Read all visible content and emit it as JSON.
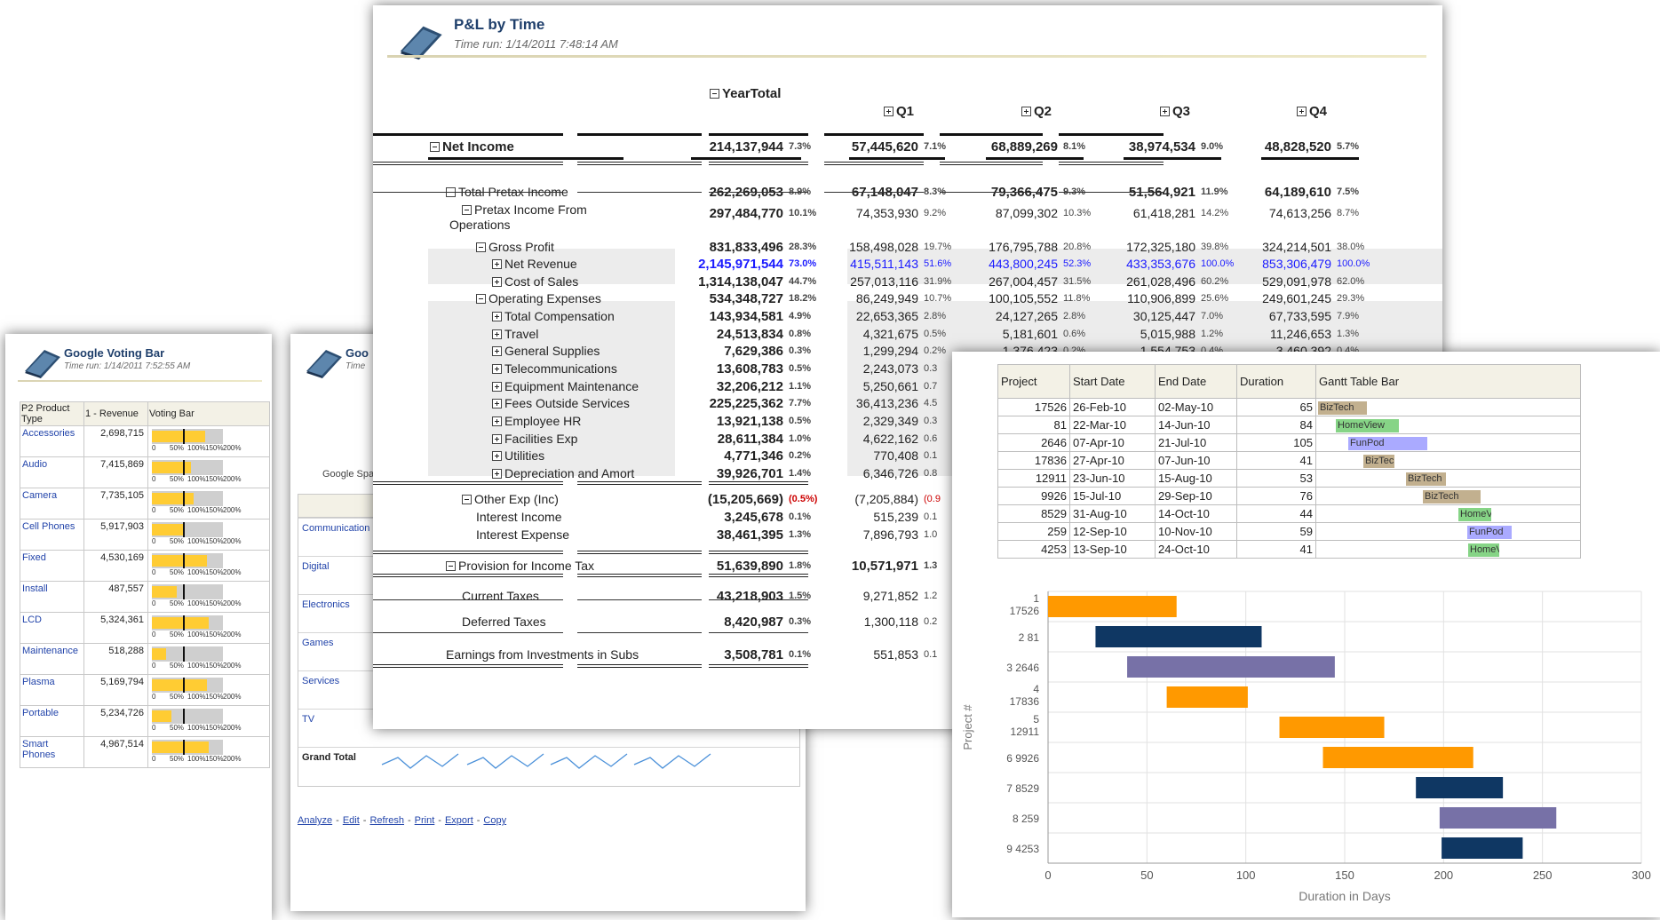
{
  "pl": {
    "title": "P&L by Time",
    "time_run": "Time run: 1/14/2011 7:48:14 AM",
    "year_total": "YearTotal",
    "quarters": [
      "Q1",
      "Q2",
      "Q3",
      "Q4"
    ],
    "rows": [
      {
        "label": "Net Income",
        "y": 0,
        "indent": 0,
        "icon": "minus",
        "bold": true,
        "cells": [
          [
            "214,137,944",
            "7.3%"
          ],
          [
            "57,445,620",
            "7.1%"
          ],
          [
            "68,889,269",
            "8.1%"
          ],
          [
            "38,974,534",
            "9.0%"
          ],
          [
            "48,828,520",
            "5.7%"
          ]
        ]
      },
      {
        "label": "Total Pretax Income",
        "indent": 1,
        "icon": "minus",
        "cells": [
          [
            "262,269,053",
            "8.9%"
          ],
          [
            "67,148,047",
            "8.3%"
          ],
          [
            "79,366,475",
            "9.3%"
          ],
          [
            "51,564,921",
            "11.9%"
          ],
          [
            "64,189,610",
            "7.5%"
          ]
        ]
      },
      {
        "label": "Pretax Income From",
        "label2": "Operations",
        "indent": 2,
        "icon": "minus",
        "cells": [
          [
            "297,484,770",
            "10.1%"
          ],
          [
            "74,353,930",
            "9.2%"
          ],
          [
            "87,099,302",
            "10.3%"
          ],
          [
            "61,418,281",
            "14.2%"
          ],
          [
            "74,613,256",
            "8.7%"
          ]
        ]
      },
      {
        "label": "Gross Profit",
        "indent": 3,
        "icon": "minus",
        "cells": [
          [
            "831,833,496",
            "28.3%"
          ],
          [
            "158,498,028",
            "19.7%"
          ],
          [
            "176,795,788",
            "20.8%"
          ],
          [
            "172,325,180",
            "39.8%"
          ],
          [
            "324,214,501",
            "38.0%"
          ]
        ]
      },
      {
        "label": "Net Revenue",
        "indent": 4,
        "icon": "plus",
        "blue": true,
        "cells": [
          [
            "2,145,971,544",
            "73.0%"
          ],
          [
            "415,511,143",
            "51.6%"
          ],
          [
            "443,800,245",
            "52.3%"
          ],
          [
            "433,353,676",
            "100.0%"
          ],
          [
            "853,306,479",
            "100.0%"
          ]
        ]
      },
      {
        "label": "Cost of Sales",
        "indent": 4,
        "icon": "plus",
        "cells": [
          [
            "1,314,138,047",
            "44.7%"
          ],
          [
            "257,013,116",
            "31.9%"
          ],
          [
            "267,004,457",
            "31.5%"
          ],
          [
            "261,028,496",
            "60.2%"
          ],
          [
            "529,091,978",
            "62.0%"
          ]
        ]
      },
      {
        "label": "Operating Expenses",
        "indent": 3,
        "icon": "minus",
        "cells": [
          [
            "534,348,727",
            "18.2%"
          ],
          [
            "86,249,949",
            "10.7%"
          ],
          [
            "100,105,552",
            "11.8%"
          ],
          [
            "110,906,899",
            "25.6%"
          ],
          [
            "249,601,245",
            "29.3%"
          ]
        ]
      },
      {
        "label": "Total Compensation",
        "indent": 4,
        "icon": "plus",
        "cells": [
          [
            "143,934,581",
            "4.9%"
          ],
          [
            "22,653,365",
            "2.8%"
          ],
          [
            "24,127,265",
            "2.8%"
          ],
          [
            "30,125,447",
            "7.0%"
          ],
          [
            "67,733,595",
            "7.9%"
          ]
        ]
      },
      {
        "label": "Travel",
        "indent": 4,
        "icon": "plus",
        "cells": [
          [
            "24,513,834",
            "0.8%"
          ],
          [
            "4,321,675",
            "0.5%"
          ],
          [
            "5,181,601",
            "0.6%"
          ],
          [
            "5,015,988",
            "1.2%"
          ],
          [
            "11,246,653",
            "1.3%"
          ]
        ]
      },
      {
        "label": "General Supplies",
        "indent": 4,
        "icon": "plus",
        "cells": [
          [
            "7,629,386",
            "0.3%"
          ],
          [
            "1,299,294",
            "0.2%"
          ],
          [
            "1,376,423",
            "0.2%"
          ],
          [
            "1,554,753",
            "0.4%"
          ],
          [
            "3,460,392",
            "0.4%"
          ]
        ]
      },
      {
        "label": "Telecommunications",
        "indent": 4,
        "icon": "plus",
        "cells": [
          [
            "13,608,783",
            "0.5%"
          ],
          [
            "2,243,073",
            "0.3"
          ]
        ]
      },
      {
        "label": "Equipment Maintenance",
        "indent": 4,
        "icon": "plus",
        "cells": [
          [
            "32,206,212",
            "1.1%"
          ],
          [
            "5,250,661",
            "0.7"
          ]
        ]
      },
      {
        "label": "Fees Outside Services",
        "indent": 4,
        "icon": "plus",
        "cells": [
          [
            "225,225,362",
            "7.7%"
          ],
          [
            "36,413,236",
            "4.5"
          ]
        ]
      },
      {
        "label": "Employee HR",
        "indent": 4,
        "icon": "plus",
        "cells": [
          [
            "13,921,138",
            "0.5%"
          ],
          [
            "2,329,349",
            "0.3"
          ]
        ]
      },
      {
        "label": "Facilities Exp",
        "indent": 4,
        "icon": "plus",
        "cells": [
          [
            "28,611,384",
            "1.0%"
          ],
          [
            "4,622,162",
            "0.6"
          ]
        ]
      },
      {
        "label": "Utilities",
        "indent": 4,
        "icon": "plus",
        "cells": [
          [
            "4,771,346",
            "0.2%"
          ],
          [
            "770,408",
            "0.1"
          ]
        ]
      },
      {
        "label": "Depreciation and Amort",
        "indent": 4,
        "icon": "plus",
        "cells": [
          [
            "39,926,701",
            "1.4%"
          ],
          [
            "6,346,726",
            "0.8"
          ]
        ]
      },
      {
        "label": "Other Exp (Inc)",
        "indent": 2,
        "icon": "minus",
        "neg": true,
        "cells": [
          [
            "(15,205,669)",
            "(0.5%)"
          ],
          [
            "(7,205,884)",
            "(0.9"
          ]
        ]
      },
      {
        "label": "Interest Income",
        "indent": 3,
        "icon": "none",
        "cells": [
          [
            "3,245,678",
            "0.1%"
          ],
          [
            "515,239",
            "0.1"
          ]
        ]
      },
      {
        "label": "Interest Expense",
        "indent": 3,
        "icon": "none",
        "cells": [
          [
            "38,461,395",
            "1.3%"
          ],
          [
            "7,896,793",
            "1.0"
          ]
        ]
      },
      {
        "label": "Provision for Income Tax",
        "indent": 1,
        "icon": "minus",
        "cells": [
          [
            "51,639,890",
            "1.8%"
          ],
          [
            "10,571,971",
            "1.3"
          ]
        ]
      },
      {
        "label": "Current Taxes",
        "indent": 2,
        "icon": "none",
        "cells": [
          [
            "43,218,903",
            "1.5%"
          ],
          [
            "9,271,852",
            "1.2"
          ]
        ]
      },
      {
        "label": "Deferred Taxes",
        "indent": 2,
        "icon": "none",
        "cells": [
          [
            "8,420,987",
            "0.3%"
          ],
          [
            "1,300,118",
            "0.2"
          ]
        ]
      },
      {
        "label": "Earnings from Investments in Subs",
        "indent": 1,
        "icon": "none",
        "cells": [
          [
            "3,508,781",
            "0.1%"
          ],
          [
            "551,853",
            "0.1"
          ]
        ]
      }
    ]
  },
  "voting": {
    "title": "Google Voting Bar",
    "time_run": "Time run: 1/14/2011 7:52:55 AM",
    "headers": [
      "P2 Product Type",
      "1 - Revenue",
      "Voting Bar"
    ],
    "scale": [
      "0",
      "50%",
      "100%",
      "150%",
      "200%"
    ],
    "rows": [
      {
        "type": "Accessories",
        "revenue": "2,698,715",
        "fill": 0.75,
        "marker": 0.44
      },
      {
        "type": "Audio",
        "revenue": "7,415,869",
        "fill": 0.55,
        "marker": 0.44
      },
      {
        "type": "Camera",
        "revenue": "7,735,105",
        "fill": 0.59,
        "marker": 0.44
      },
      {
        "type": "Cell Phones",
        "revenue": "5,917,903",
        "fill": 0.45,
        "marker": 0.44
      },
      {
        "type": "Fixed",
        "revenue": "4,530,169",
        "fill": 0.78,
        "marker": 0.44
      },
      {
        "type": "Install",
        "revenue": "487,557",
        "fill": 0.35,
        "marker": 0.44
      },
      {
        "type": "LCD",
        "revenue": "5,324,361",
        "fill": 0.8,
        "marker": 0.44
      },
      {
        "type": "Maintenance",
        "revenue": "518,288",
        "fill": 0.2,
        "marker": 0.44
      },
      {
        "type": "Plasma",
        "revenue": "5,169,794",
        "fill": 0.78,
        "marker": 0.44
      },
      {
        "type": "Portable",
        "revenue": "5,234,726",
        "fill": 0.27,
        "marker": 0.44
      },
      {
        "type": "Smart Phones",
        "revenue": "4,967,514",
        "fill": 0.8,
        "marker": 0.44
      }
    ]
  },
  "spark": {
    "title": "Goo",
    "time_run": "Time",
    "subtitle": "Google Spa",
    "categories": [
      "Communication",
      "Digital",
      "Electronics",
      "Games",
      "Services",
      "TV",
      "Grand Total"
    ],
    "links": [
      "Analyze",
      "Edit",
      "Refresh",
      "Print",
      "Export",
      "Copy"
    ],
    "separators": [
      "-",
      "-",
      "-",
      "-",
      "-"
    ]
  },
  "gantt_table": {
    "headers": [
      "Project",
      "Start Date",
      "End Date",
      "Duration",
      "Gantt Table Bar"
    ],
    "rows": [
      {
        "project": "17526",
        "start": "26-Feb-10",
        "end": "02-May-10",
        "duration": "65",
        "bar": "BizTech",
        "color": "#c2b08f"
      },
      {
        "project": "81",
        "start": "22-Mar-10",
        "end": "14-Jun-10",
        "duration": "84",
        "bar": "HomeView",
        "color": "#86d486"
      },
      {
        "project": "2646",
        "start": "07-Apr-10",
        "end": "21-Jul-10",
        "duration": "105",
        "bar": "FunPod",
        "color": "#aaaaff"
      },
      {
        "project": "17836",
        "start": "27-Apr-10",
        "end": "07-Jun-10",
        "duration": "41",
        "bar": "BizTech",
        "color": "#c2b08f"
      },
      {
        "project": "12911",
        "start": "23-Jun-10",
        "end": "15-Aug-10",
        "duration": "53",
        "bar": "BizTech",
        "color": "#c2b08f"
      },
      {
        "project": "9926",
        "start": "15-Jul-10",
        "end": "29-Sep-10",
        "duration": "76",
        "bar": "BizTech",
        "color": "#c2b08f"
      },
      {
        "project": "8529",
        "start": "31-Aug-10",
        "end": "14-Oct-10",
        "duration": "44",
        "bar": "HomeView",
        "color": "#86d486"
      },
      {
        "project": "259",
        "start": "12-Sep-10",
        "end": "10-Nov-10",
        "duration": "59",
        "bar": "FunPod",
        "color": "#aaaaff"
      },
      {
        "project": "4253",
        "start": "13-Sep-10",
        "end": "24-Oct-10",
        "duration": "41",
        "bar": "HomeView",
        "color": "#86d486"
      }
    ]
  },
  "chart_data": {
    "type": "bar",
    "orientation": "horizontal-floating",
    "xlabel": "Duration in Days",
    "ylabel": "Project #",
    "xlim": [
      0,
      300
    ],
    "xticks": [
      "0",
      "50",
      "100",
      "150",
      "200",
      "250",
      "300"
    ],
    "grid": true,
    "categories": [
      [
        "1",
        "17526"
      ],
      [
        "2 81"
      ],
      [
        "3 2646"
      ],
      [
        "4",
        "17836"
      ],
      [
        "5",
        "12911"
      ],
      [
        "6 9926"
      ],
      [
        "7 8529"
      ],
      [
        "8 259"
      ],
      [
        "9 4253"
      ]
    ],
    "bars": [
      {
        "start": 0,
        "end": 65,
        "color": "#ff9900"
      },
      {
        "start": 24,
        "end": 108,
        "color": "#0f3763"
      },
      {
        "start": 40,
        "end": 145,
        "color": "#7771a7"
      },
      {
        "start": 60,
        "end": 101,
        "color": "#ff9900"
      },
      {
        "start": 117,
        "end": 170,
        "color": "#ff9900"
      },
      {
        "start": 139,
        "end": 215,
        "color": "#ff9900"
      },
      {
        "start": 186,
        "end": 230,
        "color": "#0f3763"
      },
      {
        "start": 198,
        "end": 257,
        "color": "#7771a7"
      },
      {
        "start": 199,
        "end": 240,
        "color": "#0f3763"
      }
    ]
  }
}
